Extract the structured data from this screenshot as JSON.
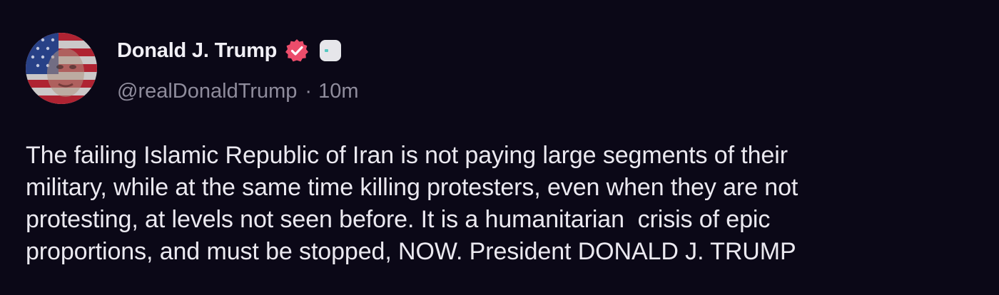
{
  "post": {
    "author": {
      "display_name": "Donald J. Trump",
      "handle": "@realDonaldTrump",
      "avatar_icon": "flag-portrait-avatar",
      "verified_icon": "verified-badge-icon",
      "extra_badge_icon": "square-badge-icon"
    },
    "separator": "·",
    "timestamp": "10m",
    "text": "The failing Islamic Republic of Iran is not paying large segments of their\nmilitary, while at the same time killing protesters, even when they are not\nprotesting, at levels not seen before. It is a humanitarian  crisis of epic\nproportions, and must be stopped, NOW. President DONALD J. TRUMP"
  },
  "colors": {
    "background": "#0b0817",
    "name": "#f1eff5",
    "meta": "#8f8c9c",
    "text": "#ebe9f0",
    "verified": "#ec4d6b"
  }
}
